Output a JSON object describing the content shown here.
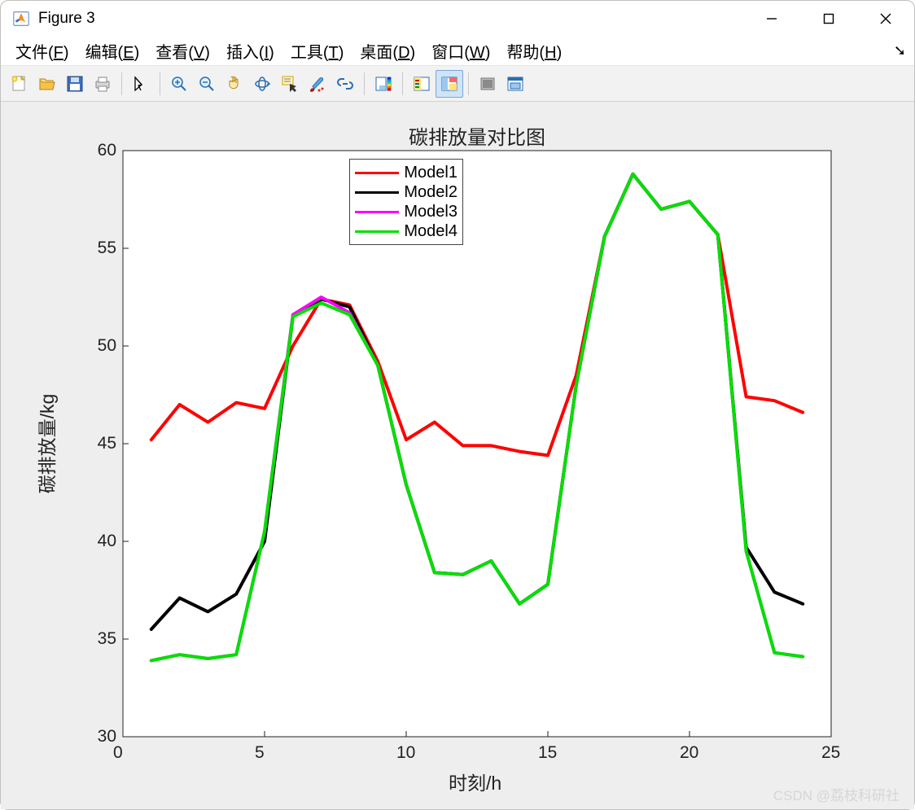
{
  "window": {
    "title": "Figure 3"
  },
  "menu": {
    "items": [
      {
        "label": "文件",
        "mnemonic": "F"
      },
      {
        "label": "编辑",
        "mnemonic": "E"
      },
      {
        "label": "查看",
        "mnemonic": "V"
      },
      {
        "label": "插入",
        "mnemonic": "I"
      },
      {
        "label": "工具",
        "mnemonic": "T"
      },
      {
        "label": "桌面",
        "mnemonic": "D"
      },
      {
        "label": "窗口",
        "mnemonic": "W"
      },
      {
        "label": "帮助",
        "mnemonic": "H"
      }
    ]
  },
  "toolbar": {
    "buttons": [
      "new-figure",
      "open",
      "save",
      "print",
      "|",
      "edit-plot",
      "|",
      "zoom-in",
      "zoom-out",
      "pan",
      "rotate-3d",
      "data-cursor",
      "brush",
      "link",
      "|",
      "insert-colorbar",
      "|",
      "insert-legend",
      "plot-tools",
      "|",
      "hide-plot-tools",
      "dock"
    ],
    "active": "plot-tools"
  },
  "watermark": "CSDN @荔枝科研社",
  "chart_data": {
    "type": "line",
    "title": "碳排放量对比图",
    "xlabel": "时刻/h",
    "ylabel": "碳排放量/kg",
    "xlim": [
      0,
      25
    ],
    "ylim": [
      30,
      60
    ],
    "xticks": [
      0,
      5,
      10,
      15,
      20,
      25
    ],
    "yticks": [
      30,
      35,
      40,
      45,
      50,
      55,
      60
    ],
    "x": [
      1,
      2,
      3,
      4,
      5,
      6,
      7,
      8,
      9,
      10,
      11,
      12,
      13,
      14,
      15,
      16,
      17,
      18,
      19,
      20,
      21,
      22,
      23,
      24
    ],
    "series": [
      {
        "name": "Model1",
        "color": "#ff0000",
        "values": [
          45.2,
          47.0,
          46.1,
          47.1,
          46.8,
          50.0,
          52.4,
          52.1,
          49.2,
          45.2,
          46.1,
          44.9,
          44.9,
          44.6,
          44.4,
          48.5,
          55.6,
          58.8,
          57.0,
          57.4,
          55.7,
          47.4,
          47.2,
          46.6
        ]
      },
      {
        "name": "Model2",
        "color": "#000000",
        "values": [
          35.5,
          37.1,
          36.4,
          37.3,
          40.0,
          51.5,
          52.4,
          52.0,
          49.0,
          42.9,
          38.4,
          38.3,
          39.0,
          36.8,
          37.8,
          48.0,
          55.6,
          58.8,
          57.0,
          57.4,
          55.7,
          39.7,
          37.4,
          36.8
        ]
      },
      {
        "name": "Model3",
        "color": "#ff00ff",
        "values": [
          33.9,
          34.2,
          34.0,
          34.2,
          40.5,
          51.6,
          52.5,
          51.7,
          49.0,
          42.9,
          38.4,
          38.3,
          39.0,
          36.8,
          37.8,
          48.0,
          55.6,
          58.8,
          57.0,
          57.4,
          55.7,
          39.5,
          34.3,
          34.1
        ]
      },
      {
        "name": "Model4",
        "color": "#00e000",
        "values": [
          33.9,
          34.2,
          34.0,
          34.2,
          40.5,
          51.5,
          52.2,
          51.6,
          49.0,
          42.9,
          38.4,
          38.3,
          39.0,
          36.8,
          37.8,
          48.0,
          55.6,
          58.8,
          57.0,
          57.4,
          55.7,
          39.5,
          34.3,
          34.1
        ]
      }
    ],
    "legend_position": "top-center",
    "line_width": 4
  }
}
